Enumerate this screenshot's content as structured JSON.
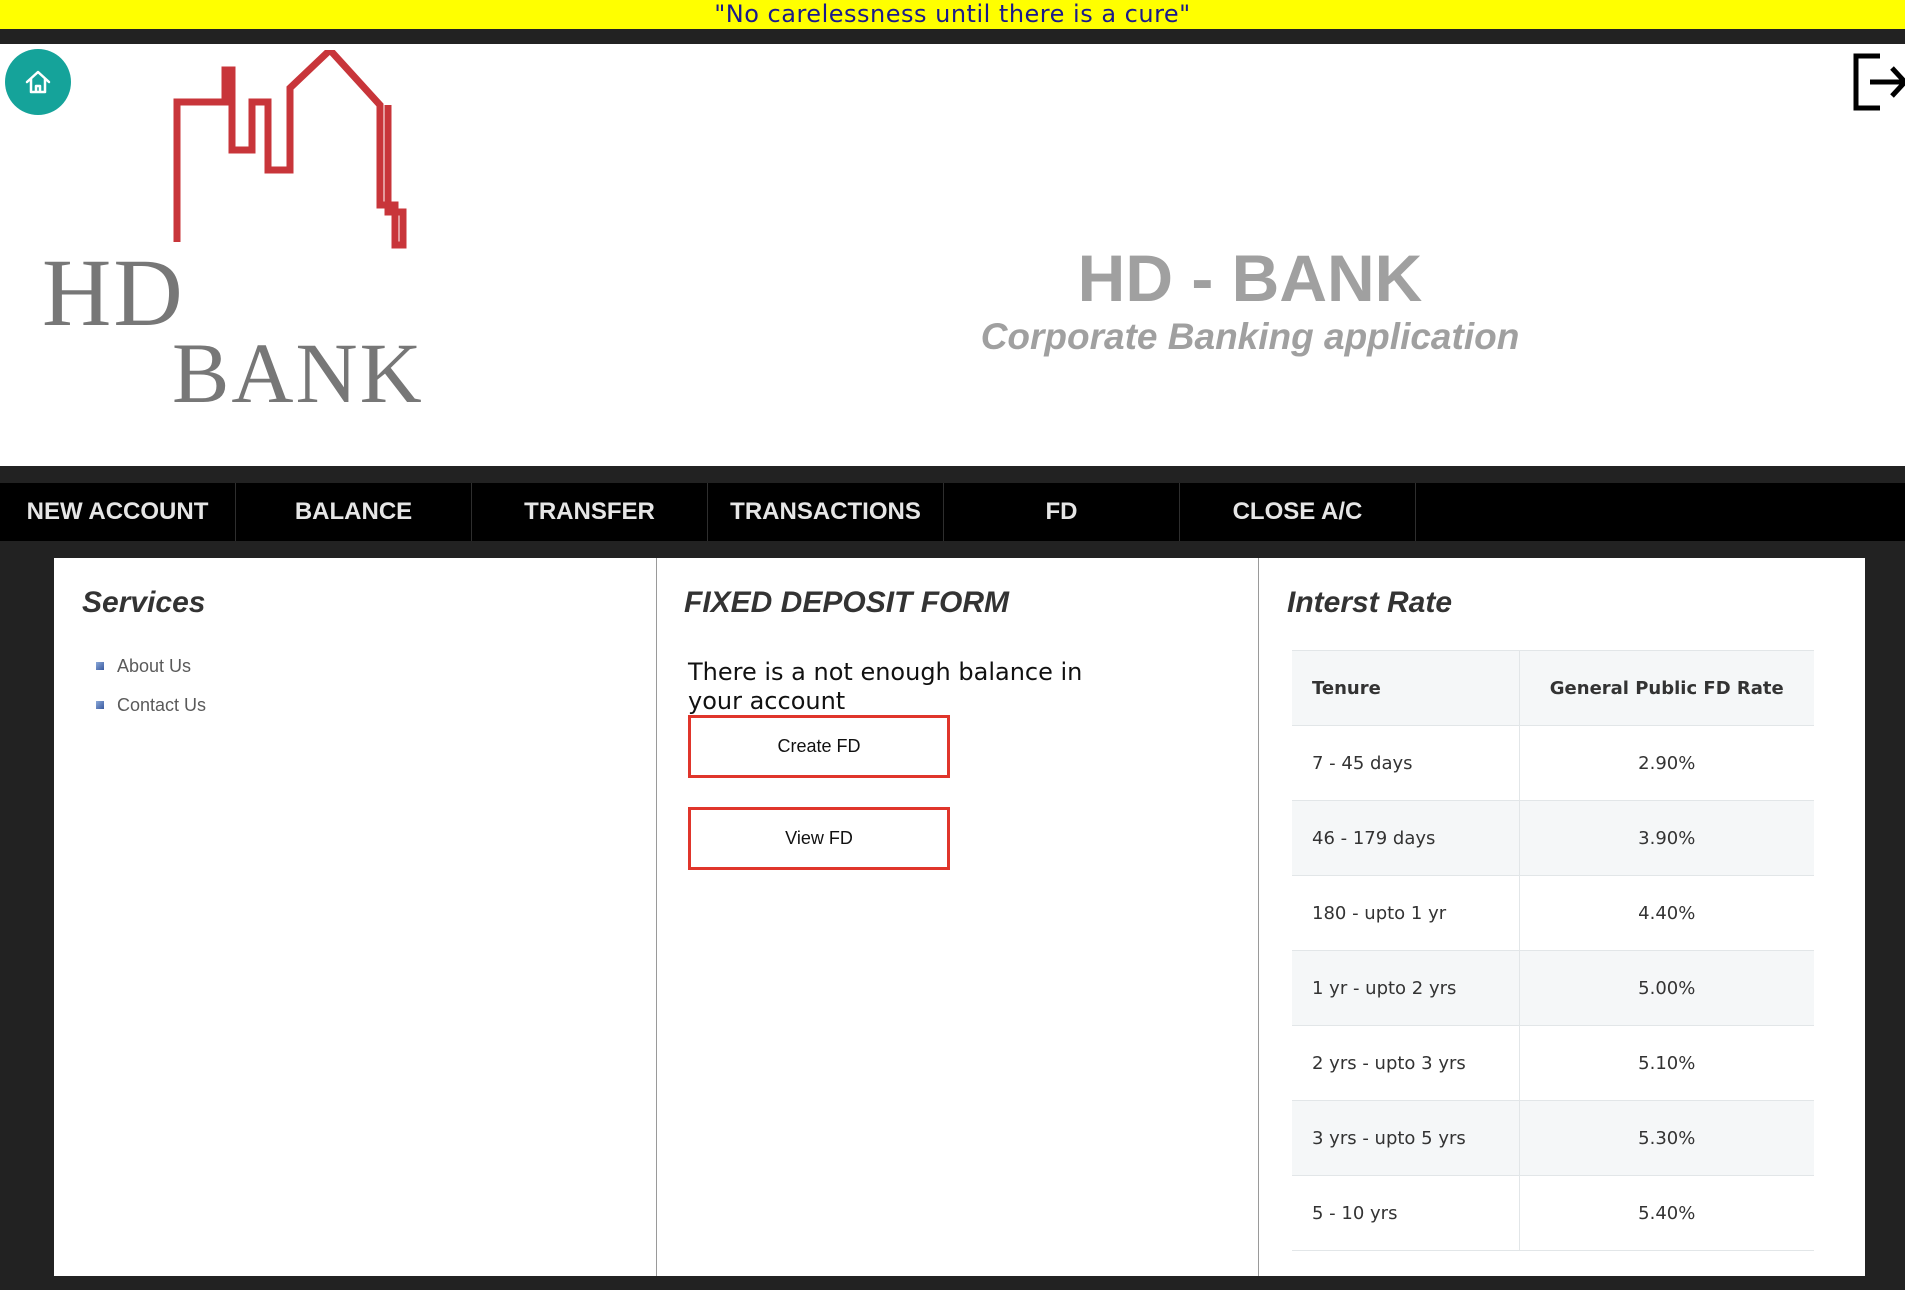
{
  "banner": {
    "text": "\"No carelessness until there is a cure\""
  },
  "header": {
    "logo_line1": "HD",
    "logo_line2": "BANK",
    "title": "HD - BANK",
    "subtitle": "Corporate Banking application"
  },
  "icons": {
    "home": "home-icon",
    "logout": "logout-icon"
  },
  "colors": {
    "banner_bg": "#ffff00",
    "home_button": "#15a39a",
    "fd_button_border": "#e0352b",
    "logo_red": "#c8353a"
  },
  "nav": {
    "items": [
      {
        "label": "NEW ACCOUNT"
      },
      {
        "label": "BALANCE"
      },
      {
        "label": "TRANSFER"
      },
      {
        "label": "TRANSACTIONS"
      },
      {
        "label": "FD"
      },
      {
        "label": "CLOSE A/C"
      }
    ]
  },
  "services": {
    "title": "Services",
    "items": [
      {
        "label": "About Us"
      },
      {
        "label": "Contact Us"
      }
    ]
  },
  "fd_form": {
    "title": "FIXED DEPOSIT FORM",
    "message": "There is a not enough balance in your account",
    "create_label": "Create FD",
    "view_label": "View FD"
  },
  "interest": {
    "title": "Interst Rate",
    "headers": [
      "Tenure",
      "General Public FD Rate"
    ],
    "rows": [
      {
        "tenure": "7 - 45 days",
        "rate": "2.90%"
      },
      {
        "tenure": "46 - 179 days",
        "rate": "3.90%"
      },
      {
        "tenure": "180 - upto 1 yr",
        "rate": "4.40%"
      },
      {
        "tenure": "1 yr - upto 2 yrs",
        "rate": "5.00%"
      },
      {
        "tenure": "2 yrs - upto 3 yrs",
        "rate": "5.10%"
      },
      {
        "tenure": "3 yrs - upto 5 yrs",
        "rate": "5.30%"
      },
      {
        "tenure": "5 - 10 yrs",
        "rate": "5.40%"
      }
    ]
  }
}
